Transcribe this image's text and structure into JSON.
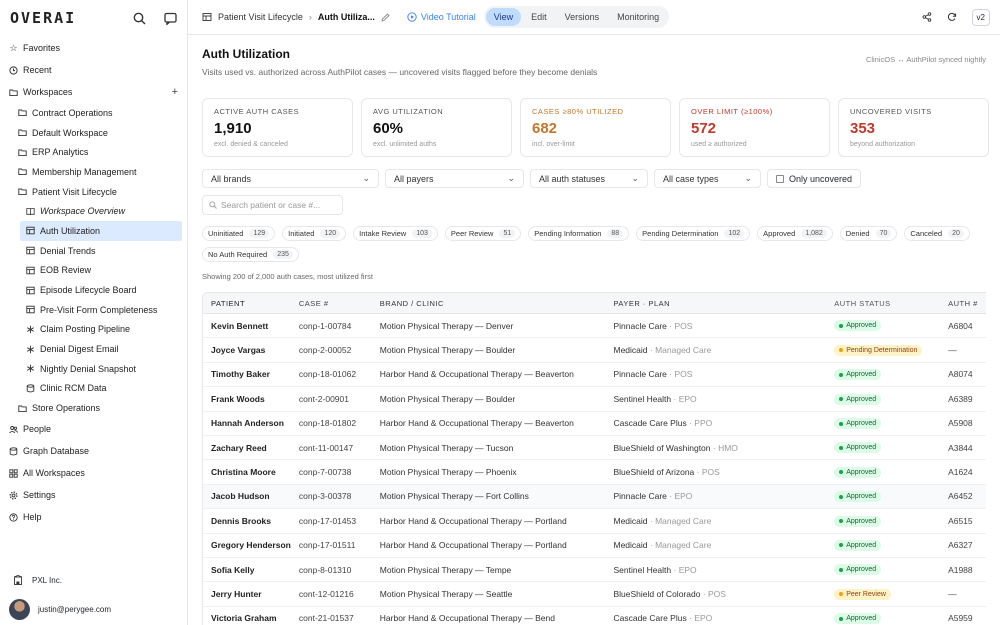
{
  "logo": "OVERAI",
  "sidebar": {
    "top": [
      {
        "label": "Favorites",
        "icon": "star-icon"
      },
      {
        "label": "Recent",
        "icon": "clock-icon"
      },
      {
        "label": "Workspaces",
        "icon": "folder-icon"
      }
    ],
    "workspaces": [
      "Contract Operations",
      "Default Workspace",
      "ERP Analytics",
      "Membership Management",
      "Patient Visit Lifecycle"
    ],
    "pages": [
      {
        "label": "Workspace Overview",
        "icon": "book-icon"
      },
      {
        "label": "Auth Utilization",
        "icon": "table-icon"
      },
      {
        "label": "Denial Trends",
        "icon": "table-icon"
      },
      {
        "label": "EOB Review",
        "icon": "table-icon"
      },
      {
        "label": "Episode Lifecycle Board",
        "icon": "table-icon"
      },
      {
        "label": "Pre-Visit Form Completeness",
        "icon": "table-icon"
      },
      {
        "label": "Claim Posting Pipeline",
        "icon": "workflow-icon"
      },
      {
        "label": "Denial Digest Email",
        "icon": "workflow-icon"
      },
      {
        "label": "Nightly Denial Snapshot",
        "icon": "workflow-icon"
      },
      {
        "label": "Clinic RCM Data",
        "icon": "database-icon"
      }
    ],
    "after": "Store Operations",
    "bottom": [
      {
        "label": "People",
        "icon": "people-icon"
      },
      {
        "label": "Graph Database",
        "icon": "database-icon"
      },
      {
        "label": "All Workspaces",
        "icon": "grid-icon"
      },
      {
        "label": "Settings",
        "icon": "gear-icon"
      },
      {
        "label": "Help",
        "icon": "help-icon"
      }
    ],
    "org": "PXL Inc.",
    "user": "justin@perygee.com"
  },
  "topbar": {
    "crumb_parent": "Patient Visit Lifecycle",
    "crumb_current": "Auth Utiliza...",
    "tutorial": "Video Tutorial",
    "modes": [
      "View",
      "Edit",
      "Versions",
      "Monitoring"
    ],
    "version": "v2"
  },
  "page": {
    "title": "Auth Utilization",
    "subtitle": "Visits used vs. authorized across AuthPilot cases — uncovered visits flagged before they become denials",
    "sync": "ClinicOS ↔ AuthPilot synced nightly"
  },
  "cards": [
    {
      "label": "ACTIVE AUTH CASES",
      "value": "1,910",
      "sub": "excl. denied & canceled",
      "color": "#111111",
      "label_color": "#555555"
    },
    {
      "label": "AVG UTILIZATION",
      "value": "60%",
      "sub": "excl. unlimited auths",
      "color": "#111111",
      "label_color": "#555555"
    },
    {
      "label": "CASES ≥80% UTILIZED",
      "value": "682",
      "sub": "incl. over-limit",
      "color": "#c2782a",
      "label_color": "#c2782a"
    },
    {
      "label": "OVER LIMIT (≥100%)",
      "value": "572",
      "sub": "used ≥ authorized",
      "color": "#c0392b",
      "label_color": "#c0392b"
    },
    {
      "label": "UNCOVERED VISITS",
      "value": "353",
      "sub": "beyond authorization",
      "color": "#c0392b",
      "label_color": "#555555"
    }
  ],
  "filters": {
    "brands": "All brands",
    "payers": "All payers",
    "statuses": "All auth statuses",
    "case_types": "All case types",
    "only_uncovered": "Only uncovered",
    "search_placeholder": "Search patient or case #..."
  },
  "chips": [
    {
      "label": "Uninitiated",
      "count": "129"
    },
    {
      "label": "Initiated",
      "count": "120"
    },
    {
      "label": "Intake Review",
      "count": "103"
    },
    {
      "label": "Peer Review",
      "count": "51"
    },
    {
      "label": "Pending Information",
      "count": "88"
    },
    {
      "label": "Pending Determination",
      "count": "102"
    },
    {
      "label": "Approved",
      "count": "1,082"
    },
    {
      "label": "Denied",
      "count": "70"
    },
    {
      "label": "Canceled",
      "count": "20"
    },
    {
      "label": "No Auth Required",
      "count": "235"
    }
  ],
  "showing": "Showing 200 of 2,000 auth cases, most utilized first",
  "table": {
    "headers": [
      "PATIENT",
      "CASE #",
      "BRAND / CLINIC",
      "PAYER · PLAN",
      "AUTH STATUS",
      "AUTH #"
    ],
    "rows": [
      {
        "patient": "Kevin Bennett",
        "case": "conp-1-00784",
        "clinic": "Motion Physical Therapy — Denver",
        "payer": "Pinnacle Care",
        "plan": "· POS",
        "status": "Approved",
        "kind": "approved",
        "auth": "A6804"
      },
      {
        "patient": "Joyce Vargas",
        "case": "conp-2-00052",
        "clinic": "Motion Physical Therapy — Boulder",
        "payer": "Medicaid",
        "plan": "· Managed Care",
        "status": "Pending Determination",
        "kind": "pending",
        "auth": "—"
      },
      {
        "patient": "Timothy Baker",
        "case": "conp-18-01062",
        "clinic": "Harbor Hand & Occupational Therapy — Beaverton",
        "payer": "Pinnacle Care",
        "plan": "· POS",
        "status": "Approved",
        "kind": "approved",
        "auth": "A8074"
      },
      {
        "patient": "Frank Woods",
        "case": "cont-2-00901",
        "clinic": "Motion Physical Therapy — Boulder",
        "payer": "Sentinel Health",
        "plan": "· EPO",
        "status": "Approved",
        "kind": "approved",
        "auth": "A6389"
      },
      {
        "patient": "Hannah Anderson",
        "case": "conp-18-01802",
        "clinic": "Harbor Hand & Occupational Therapy — Beaverton",
        "payer": "Cascade Care Plus",
        "plan": "· PPO",
        "status": "Approved",
        "kind": "approved",
        "auth": "A5908"
      },
      {
        "patient": "Zachary Reed",
        "case": "cont-11-00147",
        "clinic": "Motion Physical Therapy — Tucson",
        "payer": "BlueShield of Washington",
        "plan": "· HMO",
        "status": "Approved",
        "kind": "approved",
        "auth": "A3844"
      },
      {
        "patient": "Christina Moore",
        "case": "conp-7-00738",
        "clinic": "Motion Physical Therapy — Phoenix",
        "payer": "BlueShield of Arizona",
        "plan": "· POS",
        "status": "Approved",
        "kind": "approved",
        "auth": "A1624"
      },
      {
        "patient": "Jacob Hudson",
        "case": "conp-3-00378",
        "clinic": "Motion Physical Therapy — Fort Collins",
        "payer": "Pinnacle Care",
        "plan": "· EPO",
        "status": "Approved",
        "kind": "approved",
        "auth": "A6452"
      },
      {
        "patient": "Dennis Brooks",
        "case": "conp-17-01453",
        "clinic": "Harbor Hand & Occupational Therapy — Portland",
        "payer": "Medicaid",
        "plan": "· Managed Care",
        "status": "Approved",
        "kind": "approved",
        "auth": "A6515"
      },
      {
        "patient": "Gregory Henderson",
        "case": "conp-17-01511",
        "clinic": "Harbor Hand & Occupational Therapy — Portland",
        "payer": "Medicaid",
        "plan": "· Managed Care",
        "status": "Approved",
        "kind": "approved",
        "auth": "A6327"
      },
      {
        "patient": "Sofia Kelly",
        "case": "conp-8-01310",
        "clinic": "Motion Physical Therapy — Tempe",
        "payer": "Sentinel Health",
        "plan": "· EPO",
        "status": "Approved",
        "kind": "approved",
        "auth": "A1988"
      },
      {
        "patient": "Jerry Hunter",
        "case": "cont-12-01216",
        "clinic": "Motion Physical Therapy — Seattle",
        "payer": "BlueShield of Colorado",
        "plan": "· POS",
        "status": "Peer Review",
        "kind": "peer",
        "auth": "—"
      },
      {
        "patient": "Victoria Graham",
        "case": "cont-21-01537",
        "clinic": "Harbor Hand & Occupational Therapy — Bend",
        "payer": "Cascade Care Plus",
        "plan": "· EPO",
        "status": "Approved",
        "kind": "approved",
        "auth": "A5959"
      }
    ]
  }
}
